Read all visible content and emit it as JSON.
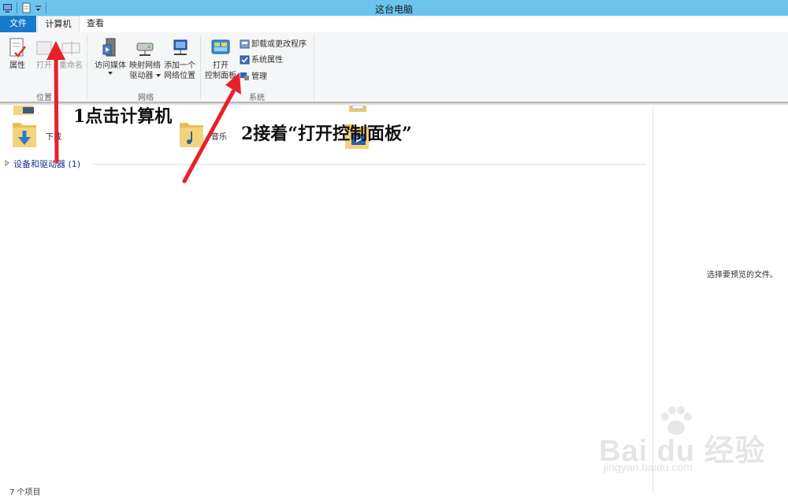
{
  "window": {
    "title": "这台电脑"
  },
  "tabs": {
    "file": "文件",
    "computer": "计算机",
    "view": "查看"
  },
  "ribbon": {
    "location": {
      "label": "位置",
      "properties": "属性",
      "open": "打开",
      "rename": "重命名"
    },
    "network": {
      "label": "网络",
      "access_media": "访问媒体",
      "map_drive_1": "映射网络",
      "map_drive_2": "驱动器",
      "add_location_1": "添加一个",
      "add_location_2": "网络位置"
    },
    "system": {
      "label": "系统",
      "open_cp_1": "打开",
      "open_cp_2": "控制面板",
      "uninstall": "卸载或更改程序",
      "sys_props": "系统属性",
      "manage": "管理"
    }
  },
  "content": {
    "folders": [
      {
        "label": "下载"
      },
      {
        "label": "音乐"
      }
    ],
    "section_header": "设备和驱动器 (1)"
  },
  "preview": {
    "text": "选择要预览的文件。"
  },
  "status": {
    "text": "7 个项目"
  },
  "annotations": {
    "step1": "1点击计算机",
    "step2": "2接着“打开控制面板”"
  },
  "watermark": {
    "brand": "Bai du 经验",
    "url": "jingyan.baidu.com"
  },
  "colors": {
    "titlebar": "#6bc3ee",
    "file_tab": "#1979ca",
    "arrow": "#e8202a",
    "section_text": "#1e3287"
  }
}
